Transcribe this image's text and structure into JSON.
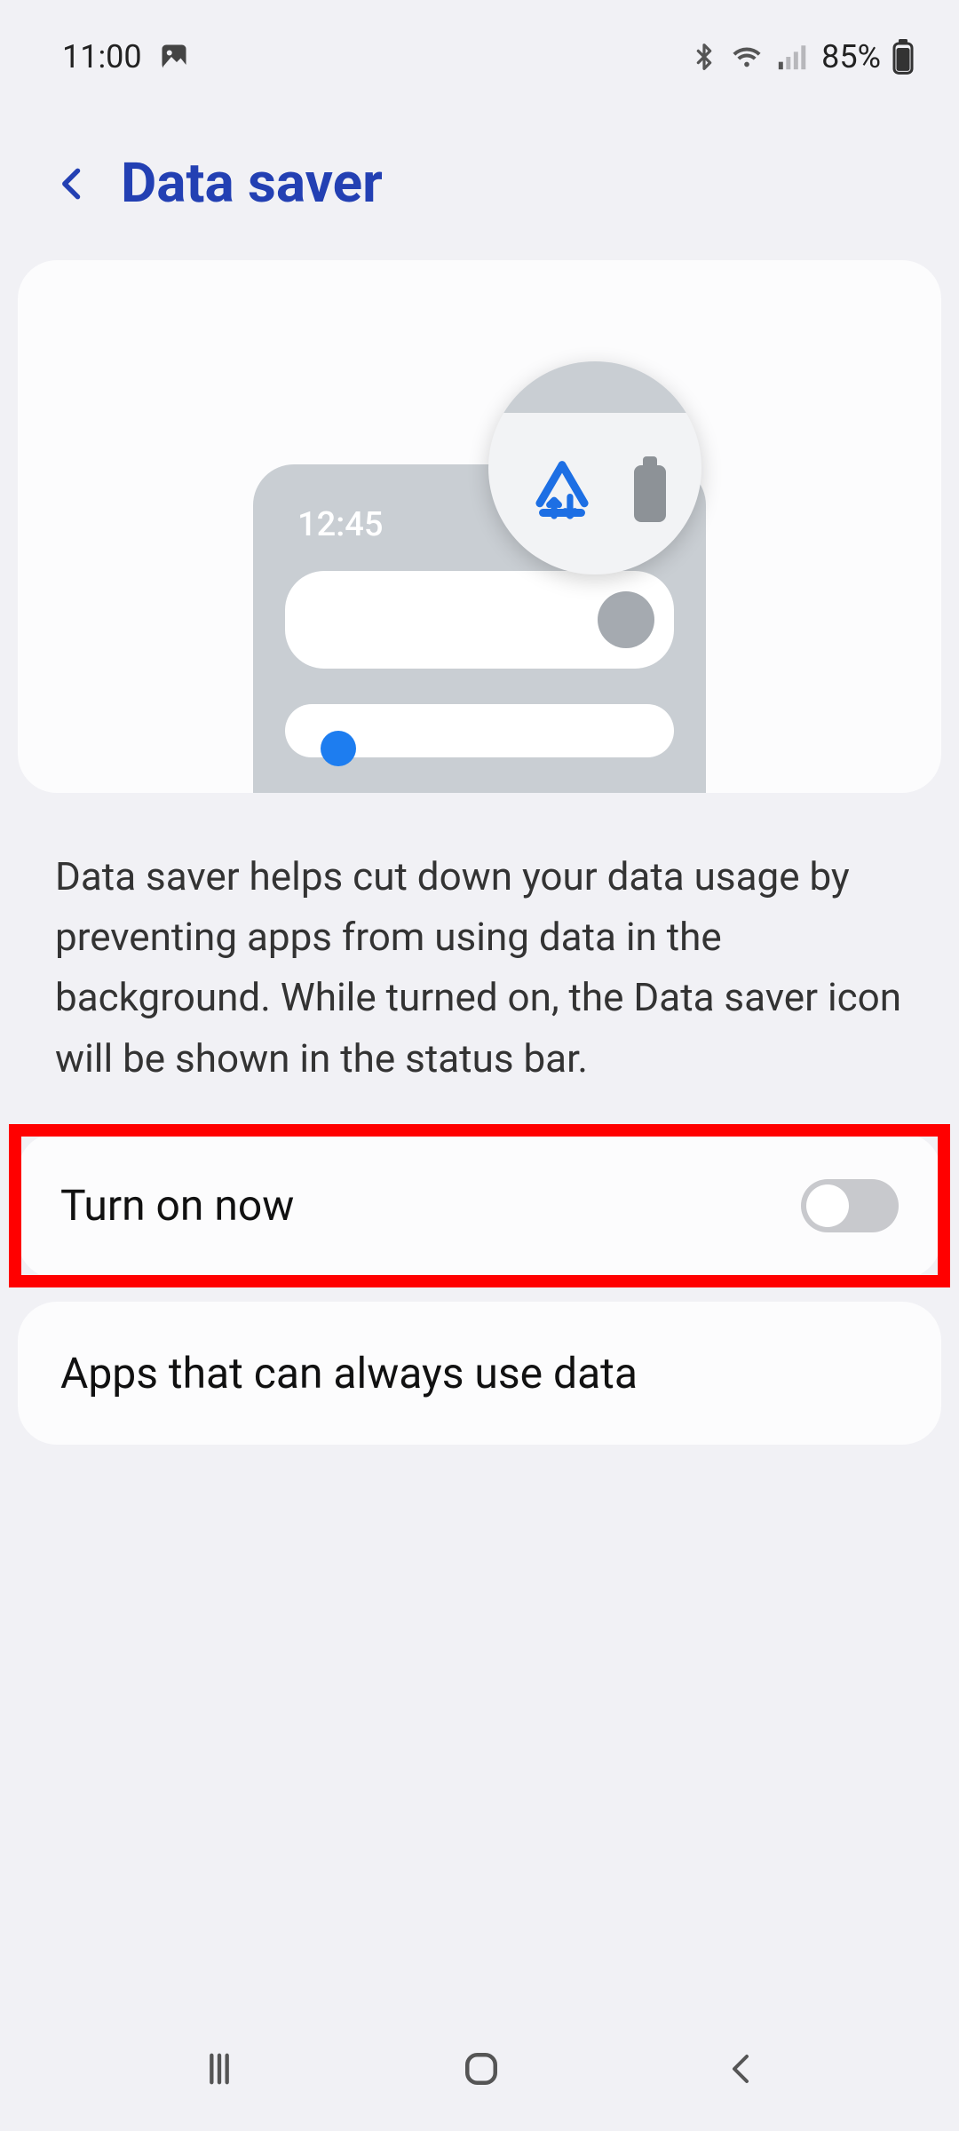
{
  "status": {
    "time": "11:00",
    "battery_pct": "85%"
  },
  "header": {
    "title": "Data saver"
  },
  "illustration": {
    "phone_time": "12:45"
  },
  "description": "Data saver helps cut down your data usage by preventing apps from using data in the background. While turned on, the Data saver icon will be shown in the status bar.",
  "rows": {
    "turn_on": {
      "label": "Turn on now",
      "on": false
    },
    "always_allow": {
      "label": "Apps that can always use data"
    }
  },
  "highlight": {
    "target": "turn-on-row"
  }
}
